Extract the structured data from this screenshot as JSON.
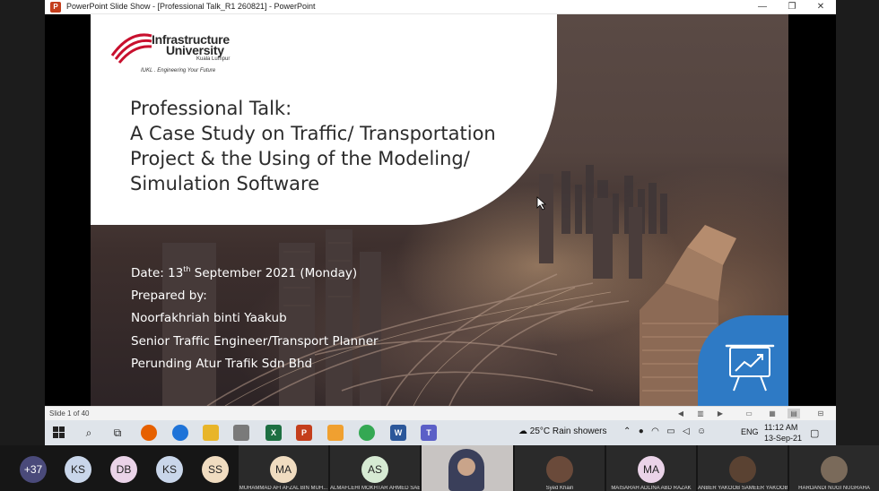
{
  "window": {
    "app_title": "PowerPoint Slide Show - [Professional Talk_R1 260821] - PowerPoint",
    "logo_letter": "P",
    "controls": {
      "minimize": "—",
      "restore": "❐",
      "close": "✕"
    }
  },
  "slide": {
    "logo": {
      "name_line1": "Infrastructure",
      "name_line2": "University",
      "city": "Kuala Lumpur",
      "tagline": "IUKL . Engineering Your Future"
    },
    "title_lines": [
      "Professional Talk:",
      "A Case Study on Traffic/ Transportation",
      "Project & the Using of the Modeling/",
      "Simulation Software"
    ],
    "date_prefix": "Date: 13",
    "date_sup": "th",
    "date_suffix": " September 2021 (Monday)",
    "prepared_by": "Prepared by:",
    "presenter": "Noorfakhriah binti Yaakub",
    "role": "Senior Traffic Engineer/Transport Planner",
    "company": "Perunding Atur Trafik Sdn Bhd"
  },
  "statusbar": {
    "slide_counter": "Slide 1 of 40"
  },
  "taskbar": {
    "weather_temp": "25°C",
    "weather_desc": "Rain showers",
    "language": "ENG",
    "time": "11:12 AM",
    "date": "13-Sep-21"
  },
  "participants": {
    "more_count": "+37",
    "avatars": [
      "KS",
      "DB",
      "KS",
      "SS"
    ],
    "tiles": [
      {
        "initials": "MA",
        "name": "MUHAMMAD AFI AFZAL BIN MUH..."
      },
      {
        "initials": "AS",
        "name": "ALMAFLEHI MOKHTAR AHMED SAE..."
      },
      {
        "initials": "",
        "name": ""
      },
      {
        "initials": "",
        "name": "Syed Khairi"
      },
      {
        "initials": "MA",
        "name": "MAISARAH ADLINA ABD RAZAK"
      },
      {
        "initials": "",
        "name": "ANBER YAKOOB SAMEER YAKOOB"
      },
      {
        "initials": "",
        "name": "HARDANDI NUGI NUGRAHA"
      }
    ]
  },
  "colors": {
    "accent_blue": "#2e7ac5",
    "iukl_red": "#c8102e",
    "powerpoint_orange": "#c43e1c"
  }
}
